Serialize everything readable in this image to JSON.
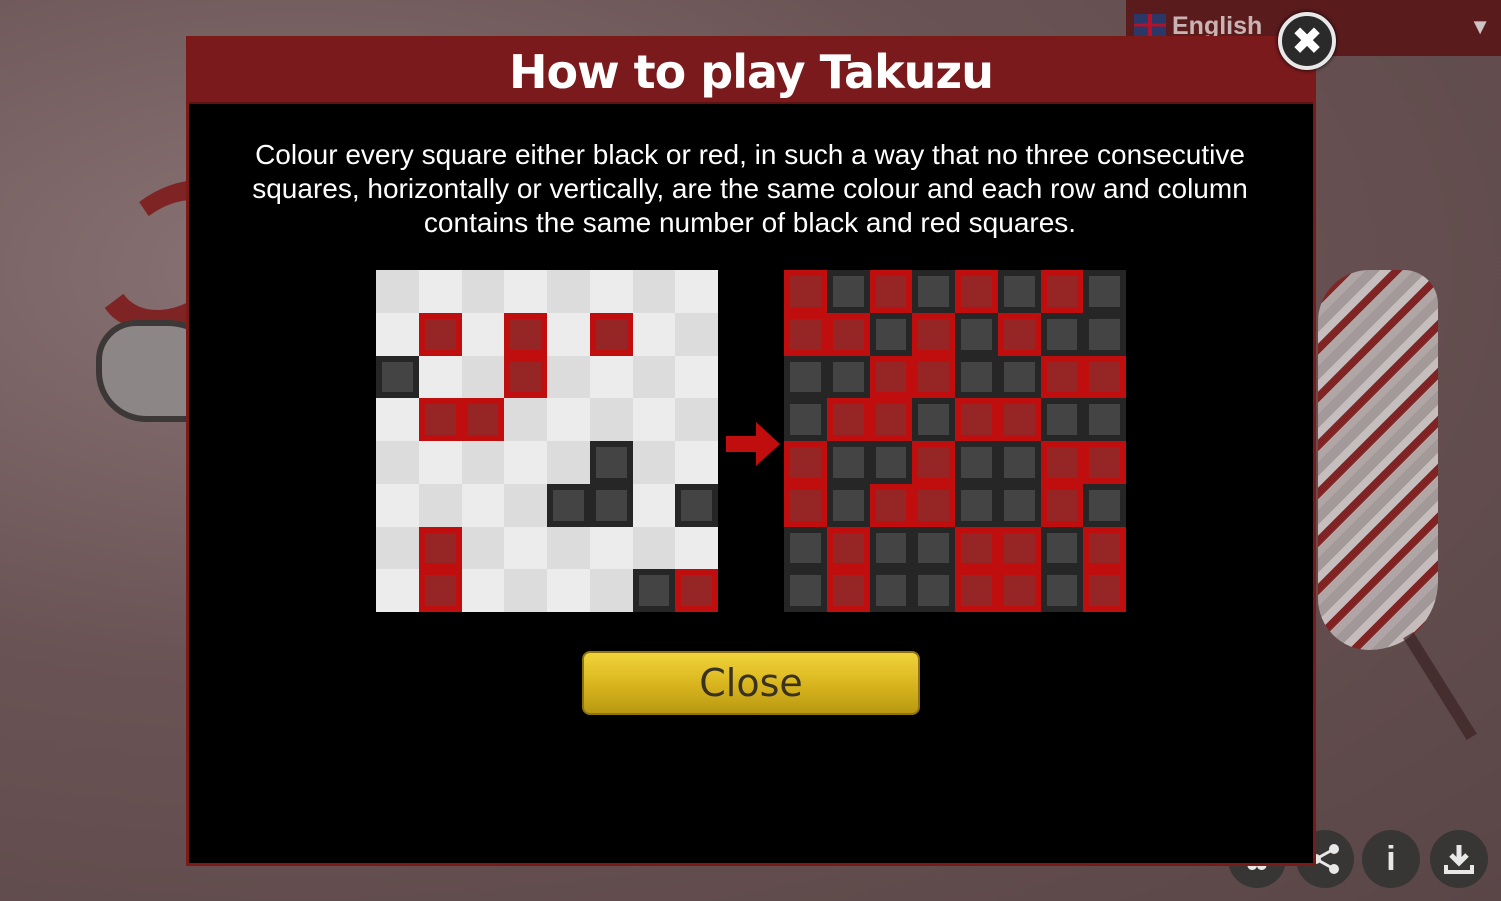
{
  "language": {
    "label": "English",
    "flag_icon": "uk-flag-icon",
    "caret_icon": "dropdown-caret-icon"
  },
  "modal": {
    "title": "How to play Takuzu",
    "description": "Colour every square either black or red, in such a way that no three consecutive squares, horizontally or vertically, are the same colour and each row and column contains the same number of black and red squares.",
    "close_button_label": "Close",
    "close_icon": "close-x-icon"
  },
  "colors": {
    "red": "#c00d0d",
    "black": "#262626",
    "header": "#7b1a1c",
    "button": "#e3c12a"
  },
  "puzzle_example": [
    "........",
    ".R.R.R..",
    "B..R....",
    ".RR.....",
    ".....B..",
    "....BB.B",
    ".R......",
    ".R....BR"
  ],
  "solution_example": [
    "RBRBRBRB",
    "RRBRBRBB",
    "BBRRBBRR",
    "BRRBRRBB",
    "RBBRBBRR",
    "RBRRBBRB",
    "BRBBRRBR",
    "BRBBRRBR"
  ],
  "toolbar_icons": [
    "settings-icon",
    "share-icon",
    "info-icon",
    "download-icon"
  ]
}
